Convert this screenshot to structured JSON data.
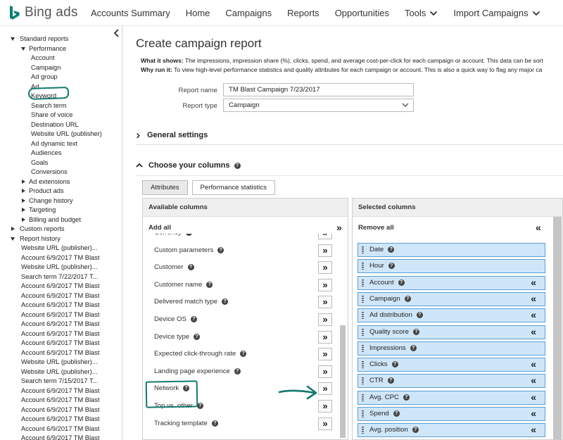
{
  "app": {
    "logo_text": "Bing ads",
    "brand_color": "#008272"
  },
  "nav": {
    "items": [
      {
        "label": "Accounts Summary"
      },
      {
        "label": "Home"
      },
      {
        "label": "Campaigns"
      },
      {
        "label": "Reports"
      },
      {
        "label": "Opportunities"
      },
      {
        "label": "Tools",
        "dropdown": true
      },
      {
        "label": "Import Campaigns",
        "dropdown": true
      }
    ]
  },
  "sidebar": {
    "standard_reports": "Standard reports",
    "performance": "Performance",
    "performance_items": [
      "Account",
      "Campaign",
      "Ad group",
      "Ad",
      "Keyword",
      "Search term",
      "Share of voice",
      "Destination URL",
      "Website URL (publisher)",
      "Ad dynamic text",
      "Audiences",
      "Goals",
      "Conversions"
    ],
    "collapsed_groups": [
      "Ad extensions",
      "Product ads",
      "Change history",
      "Targeting",
      "Billing and budget"
    ],
    "custom_reports": "Custom reports",
    "report_history": "Report history",
    "history_items": [
      "Website URL (publisher)...",
      "Account 6/9/2017 TM Blast",
      "Website URL (publisher)...",
      "Search term 7/22/2017 T...",
      "Account 6/9/2017 TM Blast",
      "Account 6/9/2017 TM Blast",
      "Account 6/9/2017 TM Blast",
      "Account 6/9/2017 TM Blast",
      "Account 6/9/2017 TM Blast",
      "Account 6/9/2017 TM Blast",
      "Account 6/9/2017 TM Blast",
      "Account 6/9/2017 TM Blast",
      "Website URL (publisher)...",
      "Website URL (publisher)...",
      "Search term 7/15/2017 T...",
      "Account 6/9/2017 TM Blast",
      "Account 6/9/2017 TM Blast",
      "Account 6/9/2017 TM Blast",
      "Account 6/9/2017 TM Blast",
      "Account 6/9/2017 TM Blast",
      "Account 6/9/2017 TM Blast"
    ]
  },
  "main": {
    "title": "Create campaign report",
    "what_label": "What it shows:",
    "what_text": " The impressions, impression share (%), clicks, spend, and average cost-per-click for each campaign or account. This data can be sort",
    "why_label": "Why run it:",
    "why_text": " To view high-level performance statistics and quality attributes for each campaign or account. This is also a quick way to flag any major ca",
    "report_name_label": "Report name",
    "report_name_value": "TM Blast Campaign 7/23/2017",
    "report_type_label": "Report type",
    "report_type_value": "Campaign",
    "general_settings": "General settings",
    "choose_columns": "Choose your columns",
    "tabs": [
      {
        "label": "Attributes",
        "active": true
      },
      {
        "label": "Performance statistics",
        "active": false
      }
    ],
    "available": {
      "header": "Available columns",
      "add_all": "Add all",
      "items": [
        "Currency",
        "Custom parameters",
        "Customer",
        "Customer name",
        "Delivered match type",
        "Device OS",
        "Device type",
        "Expected click-through rate",
        "Landing page experience",
        "Network",
        "Top vs. other",
        "Tracking template"
      ]
    },
    "selected": {
      "header": "Selected columns",
      "remove_all": "Remove all",
      "items": [
        {
          "label": "Date",
          "removable": false
        },
        {
          "label": "Hour",
          "removable": false
        },
        {
          "label": "Account",
          "removable": true
        },
        {
          "label": "Campaign",
          "removable": true
        },
        {
          "label": "Ad distribution",
          "removable": true
        },
        {
          "label": "Quality score",
          "removable": true
        },
        {
          "label": "Impressions",
          "removable": false
        },
        {
          "label": "Clicks",
          "removable": true
        },
        {
          "label": "CTR",
          "removable": true
        },
        {
          "label": "Avg. CPC",
          "removable": true
        },
        {
          "label": "Spend",
          "removable": true
        },
        {
          "label": "Avg. position",
          "removable": true
        }
      ]
    }
  },
  "icons": {
    "add": "»",
    "remove": "«",
    "help": "?"
  }
}
